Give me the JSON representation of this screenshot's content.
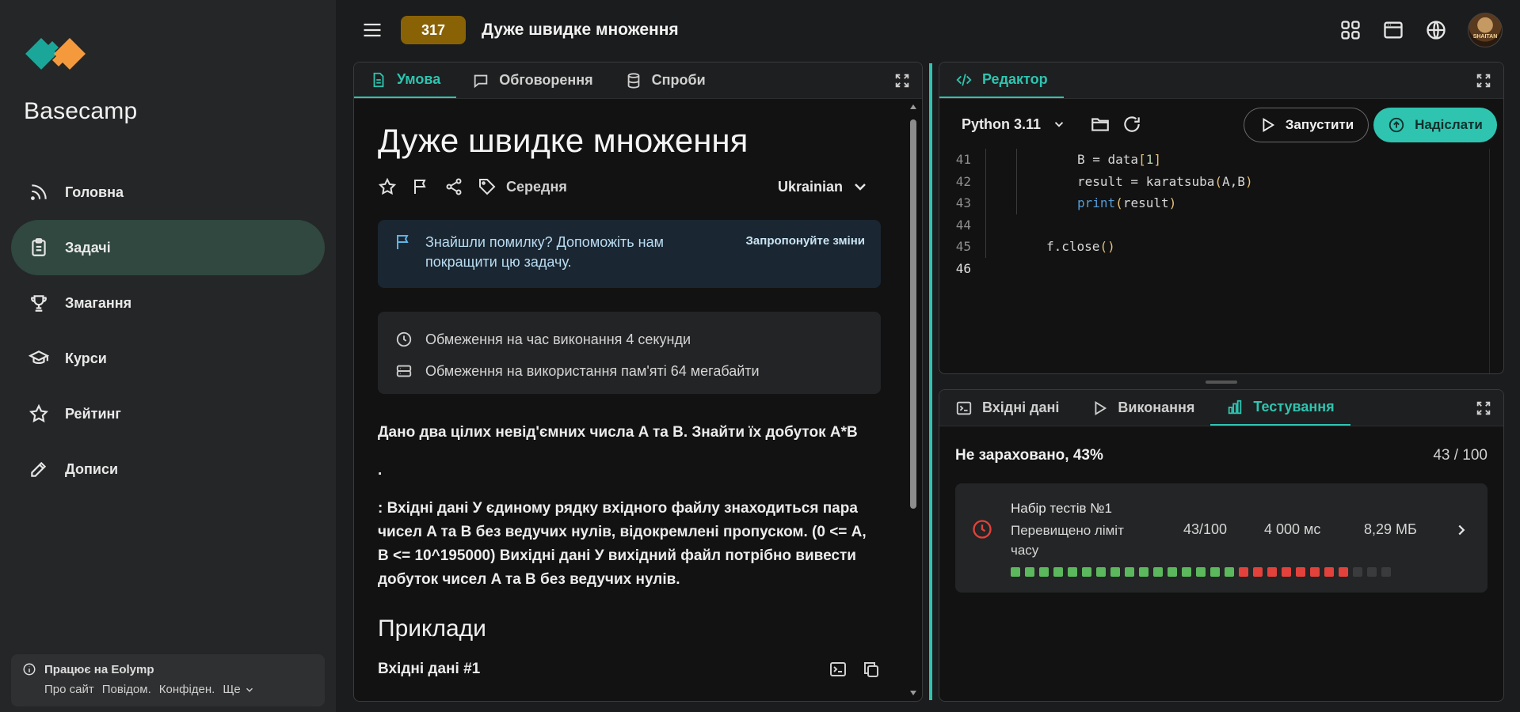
{
  "sidebar": {
    "brand": "Basecamp",
    "items": [
      {
        "label": "Головна",
        "icon": "rss-icon"
      },
      {
        "label": "Задачі",
        "icon": "clipboard-icon",
        "active": true
      },
      {
        "label": "Змагання",
        "icon": "trophy-icon"
      },
      {
        "label": "Курси",
        "icon": "graduation-cap-icon"
      },
      {
        "label": "Рейтинг",
        "icon": "star-icon"
      },
      {
        "label": "Дописи",
        "icon": "edit-icon"
      }
    ],
    "footer": {
      "title": "Працює на Eolymp",
      "links": [
        "Про сайт",
        "Повідом.",
        "Конфіден.",
        "Ще"
      ]
    }
  },
  "header": {
    "problem_id": "317",
    "title": "Дуже швидке множення",
    "badge_color": "#8a6206"
  },
  "problem": {
    "tabs": [
      "Умова",
      "Обговорення",
      "Спроби"
    ],
    "title": "Дуже швидке множення",
    "difficulty": "Середня",
    "language": "Ukrainian",
    "alert": {
      "text": "Знайшли помилку? Допоможіть нам покращити цю задачу.",
      "link": "Запропонуйте зміни"
    },
    "limits": {
      "time": "Обмеження на час виконання 4 секунди",
      "memory": "Обмеження на використання пам'яті 64 мегабайти"
    },
    "statement": [
      "Дано два цілих невід'ємних числа A та B. Знайти їх добуток A*B",
      ".",
      ": Вхідні дані У єдиному рядку вхідного файлу знаходиться пара чисел A та B без ведучих нулів, відокремлені пропуском. (0 <= A, B <= 10^195000) Вихідні дані У вихідний файл потрібно вивести добуток чисел A та B без ведучих нулів."
    ],
    "examples_title": "Приклади",
    "example_label": "Вхідні дані #1"
  },
  "editor": {
    "tab": "Редактор",
    "language": "Python 3.11",
    "run_label": "Запустити",
    "submit_label": "Надіслати",
    "accent": "#2ec4b0",
    "lines": [
      {
        "n": "41",
        "code": "B = data[1]"
      },
      {
        "n": "42",
        "code": "result = karatsuba(A,B)"
      },
      {
        "n": "43",
        "code": "print(result)"
      },
      {
        "n": "44",
        "code": ""
      },
      {
        "n": "45",
        "code": "f.close()"
      },
      {
        "n": "46",
        "code": ""
      }
    ]
  },
  "results": {
    "tabs": [
      "Вхідні дані",
      "Виконання",
      "Тестування"
    ],
    "status": "Не зараховано, 43%",
    "score": "43 / 100",
    "test_set": {
      "name": "Набір тестів №1",
      "status": "Перевищено ліміт часу",
      "score": "43/100",
      "time": "4 000 мс",
      "memory": "8,29 МБ"
    },
    "test_bars": {
      "passed": 16,
      "failed": 8,
      "pending": 3,
      "colors": {
        "passed": "#5cb85c",
        "failed": "#e2423b",
        "pending": "#3a3b3c"
      }
    }
  }
}
